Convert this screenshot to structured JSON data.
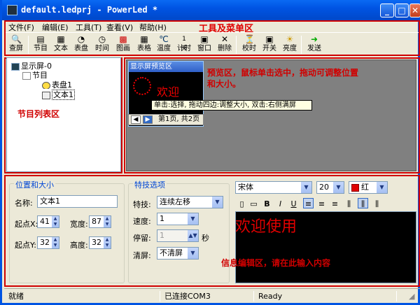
{
  "window": {
    "title": "default.ledprj - PowerLed *",
    "controls": {
      "min": "_",
      "max": "□",
      "close": "✕"
    }
  },
  "menu": {
    "items": [
      "文件(F)",
      "编辑(E)",
      "工具(T)",
      "查看(V)",
      "帮助(H)"
    ],
    "overlay_label": "工具及菜单区"
  },
  "toolbar": {
    "buttons": [
      {
        "label": "查屏",
        "icon": "search-icon"
      },
      {
        "label": "节目",
        "icon": "program-icon"
      },
      {
        "label": "文本",
        "icon": "text-icon"
      },
      {
        "label": "表盘",
        "icon": "clock-icon"
      },
      {
        "label": "时间",
        "icon": "time-icon"
      },
      {
        "label": "图画",
        "icon": "picture-icon"
      },
      {
        "label": "表格",
        "icon": "table-icon"
      },
      {
        "label": "温度",
        "icon": "temperature-icon"
      },
      {
        "label": "计时",
        "icon": "timer-icon"
      },
      {
        "label": "窗口",
        "icon": "window-icon"
      },
      {
        "label": "删除",
        "icon": "delete-icon"
      },
      {
        "label": "校时",
        "icon": "sync-time-icon"
      },
      {
        "label": "开关",
        "icon": "power-icon"
      },
      {
        "label": "亮度",
        "icon": "brightness-icon"
      },
      {
        "label": "发送",
        "icon": "send-icon"
      }
    ]
  },
  "tree": {
    "nodes": [
      "显示屏-0",
      "节目",
      "表盘1",
      "文本1"
    ],
    "region_label": "节目列表区"
  },
  "preview": {
    "window_title": "显示屏预览区",
    "region_label_line1": "预览区，鼠标单击选中，拖动可调整位置",
    "region_label_line2": "和大小。",
    "tooltip": "单击:选择, 拖动四边:调整大小, 双击:右侧满屏",
    "pager_text": "第1页, 共2页",
    "led_text": "欢迎"
  },
  "position": {
    "group_title": "位置和大小",
    "name_label": "名称:",
    "name_value": "文本1",
    "x_label": "起点X:",
    "x_value": "41",
    "width_label": "宽度:",
    "width_value": "87",
    "y_label": "起点Y:",
    "y_value": "32",
    "height_label": "高度:",
    "height_value": "32"
  },
  "effects": {
    "group_title": "特技选项",
    "effect_label": "特技:",
    "effect_value": "连续左移",
    "speed_label": "速度:",
    "speed_value": "1",
    "stay_label": "停留:",
    "stay_value": "1",
    "stay_unit": "秒",
    "clear_label": "清屏:",
    "clear_value": "不清屏"
  },
  "format": {
    "font": "宋体",
    "size": "20",
    "color_label": "红",
    "color_hex": "#e00000",
    "buttons": [
      "B",
      "I",
      "U"
    ],
    "editor_text": "欢迎使用",
    "region_label": "信息编辑区，请在此输入内容"
  },
  "status": {
    "left": "就绪",
    "middle": "已连接COM3",
    "right": "Ready"
  }
}
